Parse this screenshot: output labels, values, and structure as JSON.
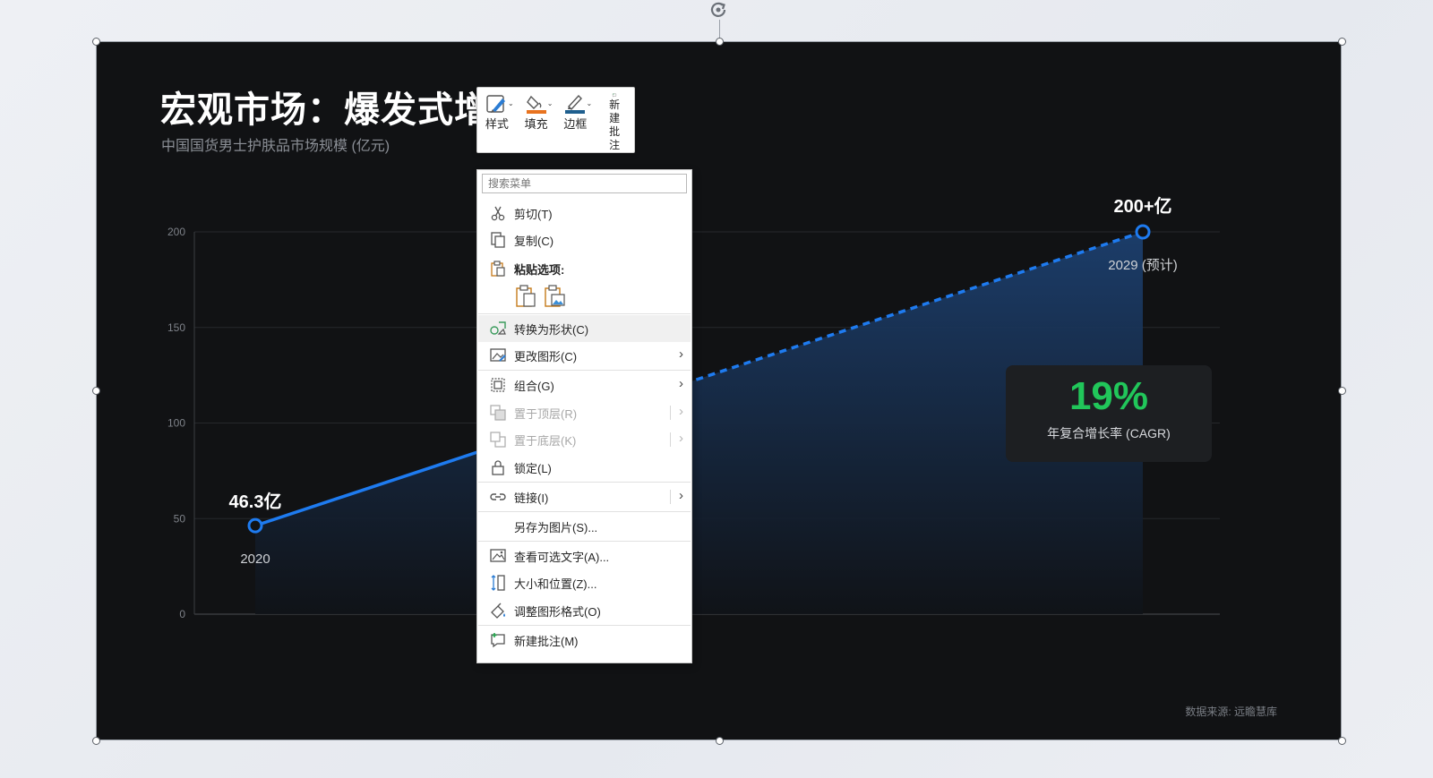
{
  "slide": {
    "title": "宏观市场：爆发式增长",
    "subtitle": "中国国货男士护肤品市场规模 (亿元)",
    "source": "数据来源: 远瞻慧库",
    "cagr": {
      "value": "19%",
      "label": "年复合增长率 (CAGR)"
    },
    "start_point": {
      "value_label": "46.3亿",
      "year_label": "2020"
    },
    "end_point": {
      "value_label": "200+亿",
      "year_label": "2029 (预计)"
    }
  },
  "chart_data": {
    "type": "area",
    "title": "宏观市场：爆发式增长",
    "subtitle": "中国国货男士护肤品市场规模 (亿元)",
    "x": [
      2020,
      2029
    ],
    "series": [
      {
        "values": [
          46.3,
          200
        ],
        "segment_styles": [
          "solid-to-2023",
          "dashed-after"
        ]
      }
    ],
    "ylim": [
      0,
      200
    ],
    "yticks": [
      "0",
      "50",
      "100",
      "150",
      "200"
    ],
    "grid": true,
    "colors": {
      "line": "#1e7bf0",
      "area_top": "#1c3f6e",
      "area_bottom": "#101318"
    }
  },
  "mini_toolbar": {
    "style_label": "样式",
    "fill_label": "填充",
    "border_label": "边框",
    "comment_label": "新建批注"
  },
  "context_menu": {
    "search_placeholder": "搜索菜单",
    "items": {
      "cut": "剪切(T)",
      "copy": "复制(C)",
      "paste_options": "粘贴选项:",
      "convert_shape": "转换为形状(C)",
      "change_graphic": "更改图形(C)",
      "group": "组合(G)",
      "bring_front": "置于顶层(R)",
      "send_back": "置于底层(K)",
      "lock": "锁定(L)",
      "link": "链接(I)",
      "save_as_picture": "另存为图片(S)...",
      "alt_text": "查看可选文字(A)...",
      "size_position": "大小和位置(Z)...",
      "format_graphic": "调整图形格式(O)",
      "new_comment": "新建批注(M)"
    }
  },
  "colors": {
    "slide_bg": "#111214",
    "accent_blue": "#1e7bf0",
    "cagr_green": "#21c65a"
  }
}
